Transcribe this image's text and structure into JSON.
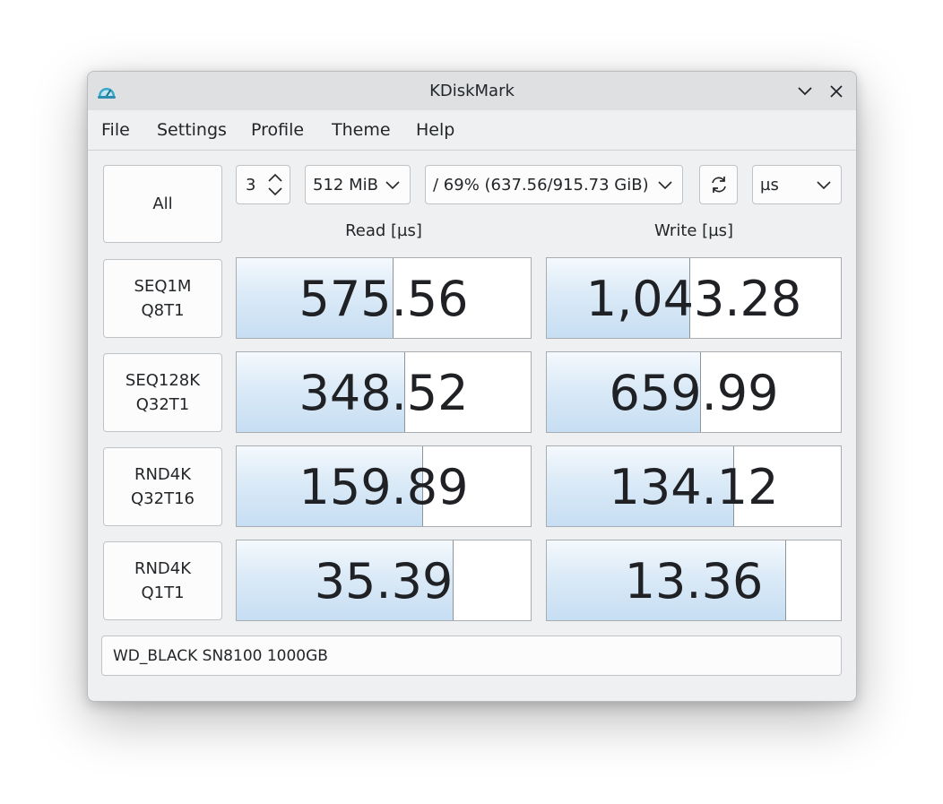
{
  "window": {
    "title": "KDiskMark",
    "app_icon": "speedometer-icon"
  },
  "menu": [
    "File",
    "Settings",
    "Profile",
    "Theme",
    "Help"
  ],
  "toolbar": {
    "all_label": "All",
    "runs": "3",
    "size": "512 MiB",
    "target": "/ 69% (637.56/915.73 GiB)",
    "units": "µs"
  },
  "headers": {
    "read": "Read [µs]",
    "write": "Write [µs]"
  },
  "tests": [
    {
      "line1": "SEQ1M",
      "line2": "Q8T1",
      "read": {
        "value": "575.56",
        "fill": 0.53
      },
      "write": {
        "value": "1,043.28",
        "fill": 0.485
      }
    },
    {
      "line1": "SEQ128K",
      "line2": "Q32T1",
      "read": {
        "value": "348.52",
        "fill": 0.57
      },
      "write": {
        "value": "659.99",
        "fill": 0.52
      }
    },
    {
      "line1": "RND4K",
      "line2": "Q32T16",
      "read": {
        "value": "159.89",
        "fill": 0.63
      },
      "write": {
        "value": "134.12",
        "fill": 0.635
      }
    },
    {
      "line1": "RND4K",
      "line2": "Q1T1",
      "read": {
        "value": "35.39",
        "fill": 0.735
      },
      "write": {
        "value": "13.36",
        "fill": 0.81
      }
    }
  ],
  "device": "WD_BLACK SN8100 1000GB"
}
